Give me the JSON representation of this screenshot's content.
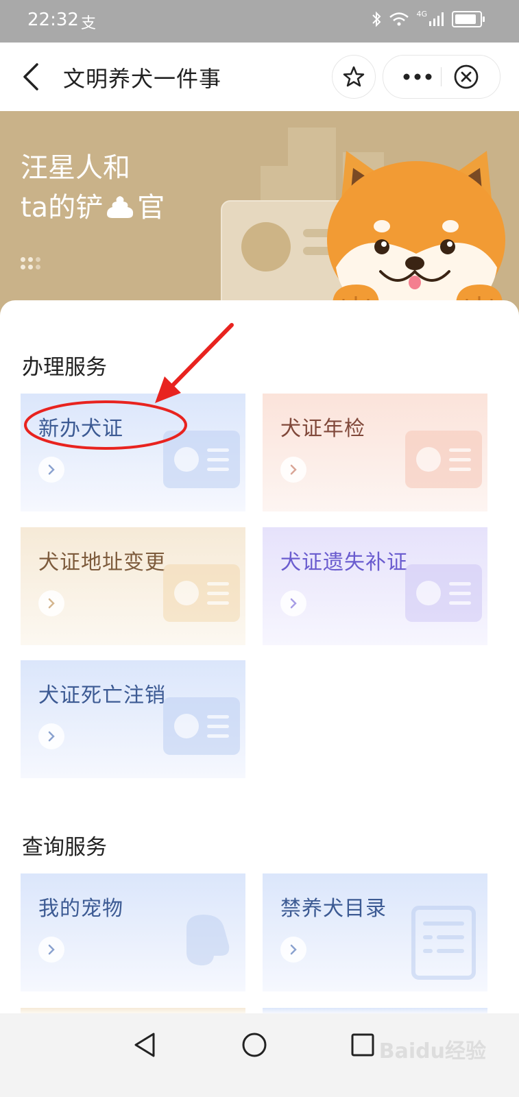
{
  "status_bar": {
    "time": "22:32",
    "app_glyph": "支",
    "network": "4G"
  },
  "nav": {
    "title": "文明养犬一件事"
  },
  "banner": {
    "title_line1": "汪星人和",
    "title_line2": "ta的铲",
    "title_line2_end": "官"
  },
  "sections": {
    "service": {
      "title": "办理服务",
      "tiles": [
        {
          "label": "新办犬证"
        },
        {
          "label": "犬证年检"
        },
        {
          "label": "犬证地址变更"
        },
        {
          "label": "犬证遗失补证"
        },
        {
          "label": "犬证死亡注销"
        }
      ]
    },
    "query": {
      "title": "查询服务",
      "tiles": [
        {
          "label": "我的宠物"
        },
        {
          "label": "禁养犬目录"
        }
      ]
    }
  },
  "watermark": "Baidu经验",
  "colors": {
    "status_bar_bg": "#a9a9a9",
    "banner_bg": "#c9b289",
    "annotation_red": "#e8231f",
    "blue_tile_text": "#3c5a93",
    "purple_tile_text": "#6a5ccf"
  },
  "icons": [
    "back-arrow-icon",
    "star-icon",
    "more-icon",
    "close-circle-icon",
    "chevron-right-icon",
    "home-circle-icon",
    "back-triangle-icon",
    "recents-square-icon",
    "bluetooth-icon",
    "wifi-icon",
    "signal-icon",
    "battery-icon"
  ]
}
